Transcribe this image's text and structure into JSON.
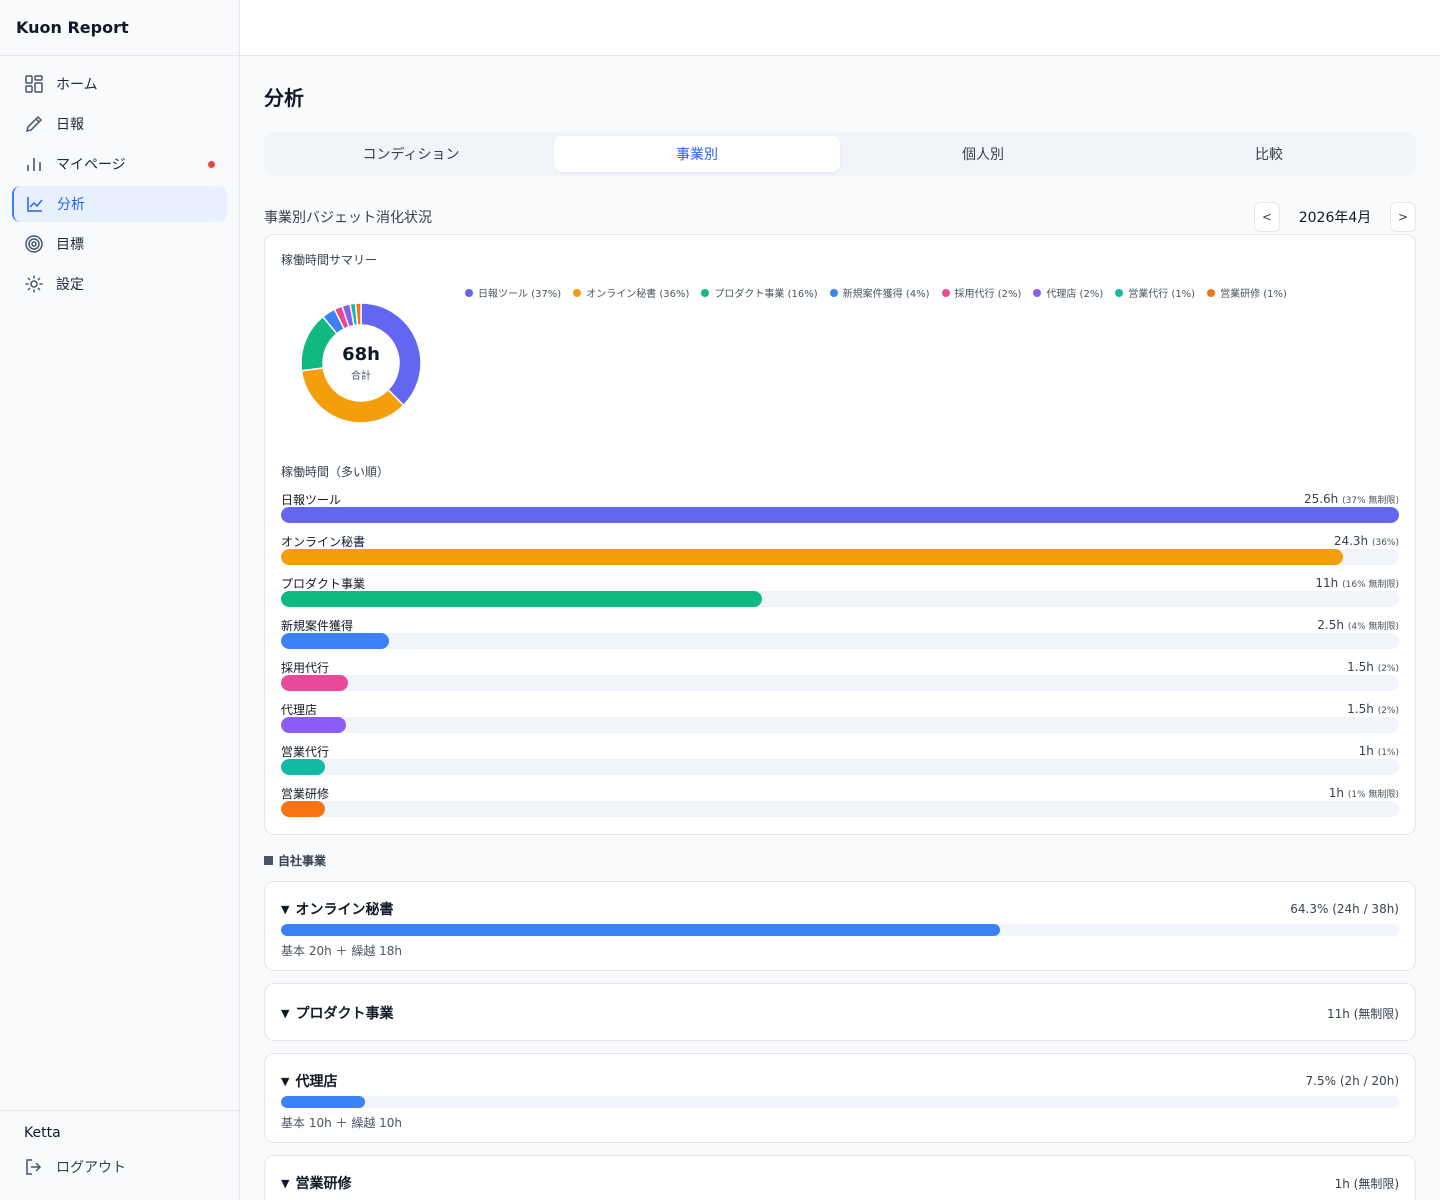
{
  "app": {
    "title": "Kuon Report"
  },
  "sidebar": {
    "items": [
      {
        "label": "ホーム",
        "icon": "grid-icon"
      },
      {
        "label": "日報",
        "icon": "pencil-icon"
      },
      {
        "label": "マイページ",
        "icon": "bar-chart-icon",
        "notification": true
      },
      {
        "label": "分析",
        "icon": "line-chart-icon",
        "active": true
      },
      {
        "label": "目標",
        "icon": "target-icon"
      },
      {
        "label": "設定",
        "icon": "gear-icon"
      }
    ],
    "user": "Ketta",
    "logout_label": "ログアウト"
  },
  "page": {
    "title": "分析"
  },
  "tabs": [
    {
      "label": "コンディション"
    },
    {
      "label": "事業別",
      "active": true
    },
    {
      "label": "個人別"
    },
    {
      "label": "比較"
    }
  ],
  "section": {
    "title": "事業別バジェット消化状況",
    "prev_label": "<",
    "month": "2026年4月",
    "next_label": ">"
  },
  "summary": {
    "title": "稼働時間サマリー",
    "total": "68h",
    "total_caption": "合計",
    "bars_title": "稼働時間（多い順）"
  },
  "chart_data": {
    "type": "pie",
    "title": "稼働時間サマリー",
    "categories": [
      "日報ツール",
      "オンライン秘書",
      "プロダクト事業",
      "新規案件獲得",
      "採用代行",
      "代理店",
      "営業代行",
      "営業研修"
    ],
    "values": [
      25.6,
      24.3,
      11,
      2.5,
      1.5,
      1.5,
      1,
      1
    ],
    "percents": [
      37,
      36,
      16,
      4,
      2,
      2,
      1,
      1
    ],
    "colors": [
      "#6366f1",
      "#f59e0b",
      "#10b981",
      "#3b82f6",
      "#ec4899",
      "#8b5cf6",
      "#14b8a6",
      "#f97316"
    ],
    "legend": [
      "日報ツール (37%)",
      "オンライン秘書 (36%)",
      "プロダクト事業 (16%)",
      "新規案件獲得 (4%)",
      "採用代行 (2%)",
      "代理店 (2%)",
      "営業代行 (1%)",
      "営業研修 (1%)"
    ],
    "legend_position": "top"
  },
  "bars": [
    {
      "name": "日報ツール",
      "value": "25.6h",
      "note": "(37% 無制限)",
      "fraction": 1.0,
      "color": "#6366f1"
    },
    {
      "name": "オンライン秘書",
      "value": "24.3h",
      "note": "(36%)",
      "fraction": 0.95,
      "color": "#f59e0b"
    },
    {
      "name": "プロダクト事業",
      "value": "11h",
      "note": "(16% 無制限)",
      "fraction": 0.43,
      "color": "#10b981"
    },
    {
      "name": "新規案件獲得",
      "value": "2.5h",
      "note": "(4% 無制限)",
      "fraction": 0.097,
      "color": "#3b82f6"
    },
    {
      "name": "採用代行",
      "value": "1.5h",
      "note": "(2%)",
      "fraction": 0.06,
      "color": "#ec4899"
    },
    {
      "name": "代理店",
      "value": "1.5h",
      "note": "(2%)",
      "fraction": 0.058,
      "color": "#8b5cf6"
    },
    {
      "name": "営業代行",
      "value": "1h",
      "note": "(1%)",
      "fraction": 0.039,
      "color": "#14b8a6"
    },
    {
      "name": "営業研修",
      "value": "1h",
      "note": "(1% 無制限)",
      "fraction": 0.039,
      "color": "#f97316"
    }
  ],
  "group": {
    "label": "自社事業"
  },
  "businesses": [
    {
      "name": "オンライン秘書",
      "value": "64.3% (24h / 38h)",
      "progress": 0.643,
      "sub": "基本 20h ＋ 繰越 18h"
    },
    {
      "name": "プロダクト事業",
      "value": "11h (無制限)"
    },
    {
      "name": "代理店",
      "value": "7.5% (2h / 20h)",
      "progress": 0.075,
      "sub": "基本 10h ＋ 繰越 10h"
    },
    {
      "name": "営業研修",
      "value": "1h (無制限)"
    }
  ]
}
